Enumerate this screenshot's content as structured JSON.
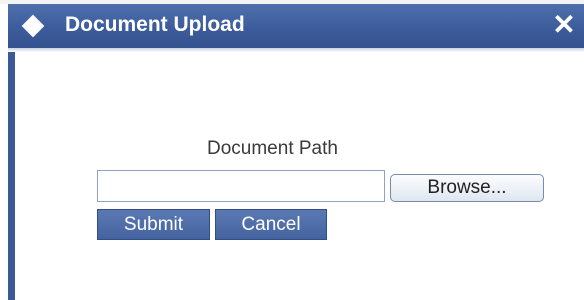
{
  "dialog": {
    "title": "Document Upload",
    "close_glyph": "✕",
    "title_icon": "diamond-icon",
    "close_icon": "close-icon"
  },
  "form": {
    "path_label": "Document Path",
    "path_value": "",
    "browse_label": "Browse...",
    "submit_label": "Submit",
    "cancel_label": "Cancel"
  },
  "colors": {
    "titlebar": "#3d5c9b",
    "button": "#45649f",
    "text_on_accent": "#ffffff"
  }
}
